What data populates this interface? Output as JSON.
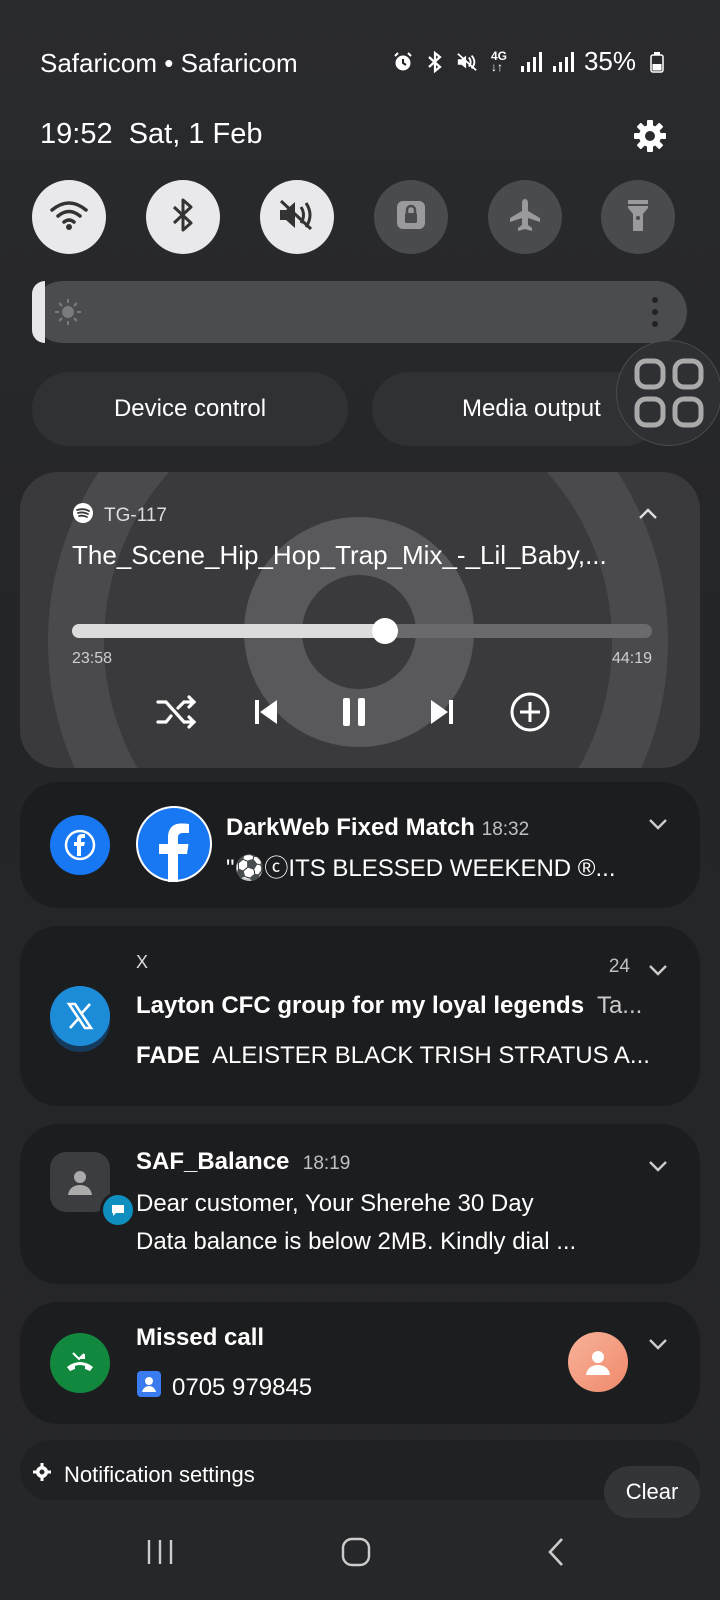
{
  "status": {
    "carrier": "Safaricom • Safaricom",
    "battery": "35%",
    "icons": [
      "alarm-icon",
      "bluetooth-icon",
      "mute-icon",
      "4g-icon",
      "signal-icon",
      "signal-icon",
      "battery-icon"
    ]
  },
  "header": {
    "time": "19:52",
    "date": "Sat, 1 Feb"
  },
  "quick_toggles": [
    {
      "name": "wifi",
      "state": "on"
    },
    {
      "name": "bluetooth",
      "state": "on"
    },
    {
      "name": "sound-mute",
      "state": "on"
    },
    {
      "name": "rotation-lock",
      "state": "off"
    },
    {
      "name": "airplane-mode",
      "state": "off"
    },
    {
      "name": "flashlight",
      "state": "off"
    }
  ],
  "brightness": {
    "level": 0.02
  },
  "device_control": {
    "label": "Device control"
  },
  "media_output": {
    "label": "Media output"
  },
  "media": {
    "app_name": "TG-117",
    "title": "The_Scene_Hip_Hop_Trap_Mix_-_Lil_Baby,...",
    "elapsed": "23:58",
    "total": "44:19",
    "progress": 0.54
  },
  "notifications": [
    {
      "sender": "DarkWeb Fixed Match",
      "time": "18:32",
      "text": "\"⚽ⓒITS BLESSED WEEKEND ®..."
    },
    {
      "app": "X",
      "count": "24",
      "title": "Layton CFC group for my loyal legends",
      "title_suffix": "Ta...",
      "text_bold": "FADE",
      "text": "ALEISTER BLACK TRISH STRATUS A..."
    },
    {
      "sender": "SAF_Balance",
      "time": "18:19",
      "line1": "Dear customer, Your Sherehe 30 Day",
      "line2": "Data balance is below 2MB. Kindly dial ..."
    },
    {
      "title": "Missed call",
      "number": "0705 979845"
    }
  ],
  "footer": {
    "settings_label": "Notification settings",
    "clear_label": "Clear"
  }
}
